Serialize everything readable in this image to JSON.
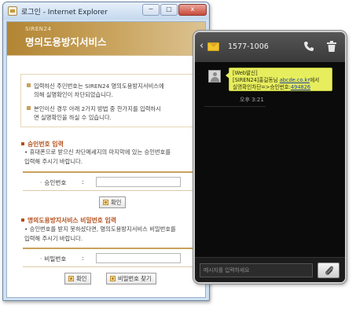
{
  "window": {
    "title": "로그인 - Internet Explorer",
    "controls": {
      "minimize": "─",
      "maximize": "□",
      "close": "x"
    }
  },
  "banner": {
    "brand": "SIREN24",
    "title": "명의도용방지서비스"
  },
  "notice": {
    "item1": [
      "입력하신 주민번호는 SIREN24 명의도용방지서비스에",
      "의해 실명확인이 차단되었습니다."
    ],
    "item2": [
      "본인이신 경우 아래 2가지 방법 중 한가지를 입력하시",
      "면 실명확인을 하실 수 있습니다."
    ]
  },
  "approval": {
    "title": "승인번호 입력",
    "desc": [
      "• 휴대폰으로 받으신 차단메세지의 마지막에 있는 승인번호를",
      "  입력해 주시기 바랍니다."
    ],
    "label": "승인번호",
    "colon": ":",
    "input_value": "",
    "confirm": "확인"
  },
  "password": {
    "title": "명의도용방지서비스 비밀번호 입력",
    "desc": [
      "• 승인번호를 받지 못하셨다면, 명의도용방지서비스 비밀번호를",
      "  입력해 주시기 바랍니다."
    ],
    "label": "비밀번호",
    "colon": ":",
    "input_value": "",
    "confirm": "확인",
    "find": "비밀번호 찾기"
  },
  "phone": {
    "back": "‹",
    "sender": "1577-1006",
    "message": {
      "line1": "[Web발신]",
      "line2a": "[SIREN24]홍길동님 ",
      "line2_link": "abcde.co.kr",
      "line2b": "에서",
      "line3a": "실명확인차단=>승인번호:",
      "line3_code": "494826"
    },
    "time": "오후 3:21",
    "input_placeholder": "메시지를 입력하세요"
  }
}
